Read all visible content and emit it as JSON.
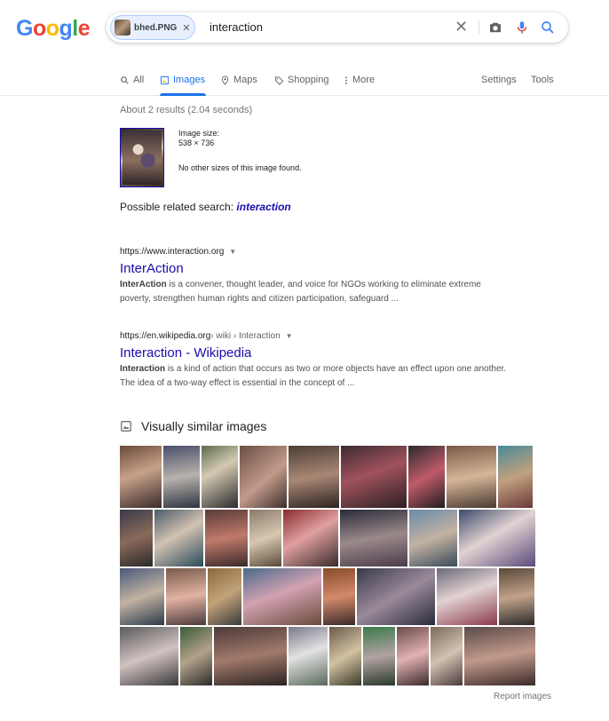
{
  "logo": {
    "text": "Google"
  },
  "search": {
    "chip_label": "bhed.PNG",
    "query": "interaction"
  },
  "tabs": [
    {
      "label": "All",
      "icon": "search-icon"
    },
    {
      "label": "Images",
      "icon": "image-icon"
    },
    {
      "label": "Maps",
      "icon": "map-pin-icon"
    },
    {
      "label": "Shopping",
      "icon": "tag-icon"
    },
    {
      "label": "More",
      "icon": "more-vert-icon"
    }
  ],
  "tools": {
    "settings": "Settings",
    "tools": "Tools"
  },
  "stats": "About 2 results (2.04 seconds)",
  "query_image": {
    "size_label": "Image size:",
    "size_value": "538 × 736",
    "no_other": "No other sizes of this image found."
  },
  "related": {
    "prefix": "Possible related search:",
    "term": "interaction"
  },
  "results": [
    {
      "url_host": "https://www.interaction.org",
      "url_path": "",
      "title": "InterAction",
      "snippet_bold": "InterAction",
      "snippet_rest": " is a convener, thought leader, and voice for NGOs working to eliminate extreme poverty, strengthen human rights and citizen participation, safeguard ..."
    },
    {
      "url_host": "https://en.wikipedia.org",
      "url_path": " › wiki › Interaction",
      "title": "Interaction - Wikipedia",
      "snippet_bold": "Interaction",
      "snippet_rest": " is a kind of action that occurs as two or more objects have an effect upon one another. The idea of a two-way effect is essential in the concept of ..."
    }
  ],
  "visually_similar": {
    "title": "Visually similar images"
  },
  "report": "Report images",
  "colors": {
    "link": "#1a0dab",
    "accent": "#1a73e8"
  }
}
